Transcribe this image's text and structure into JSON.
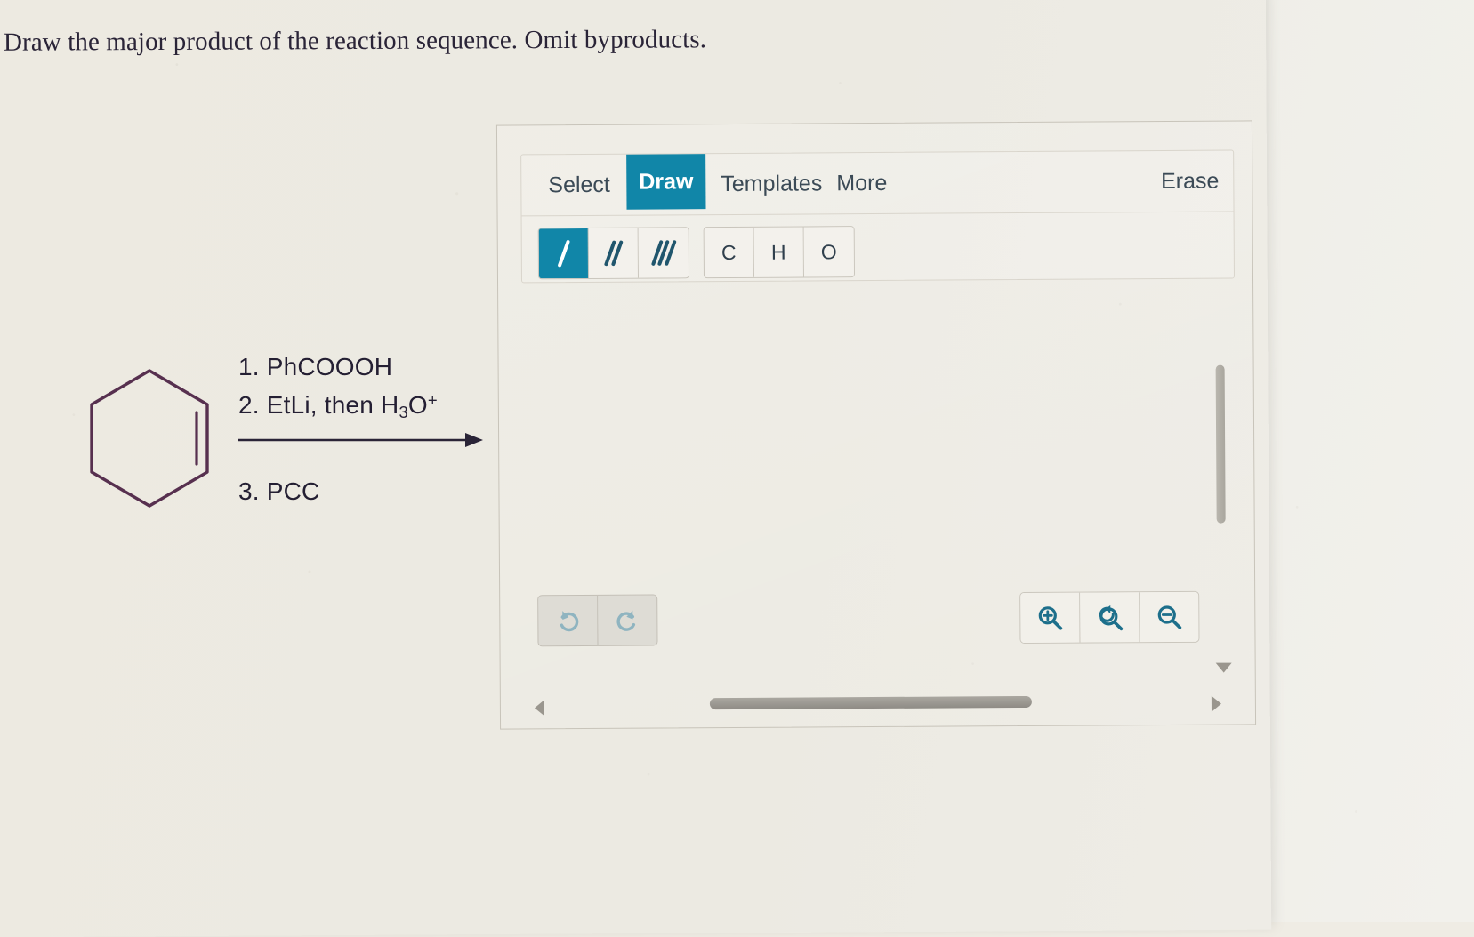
{
  "prompt": {
    "text": "Draw the major product of the reaction sequence. Omit byproducts."
  },
  "reaction": {
    "reactant_name": "cyclohexene",
    "conditions": [
      {
        "number": "1.",
        "reagent": "PhCOOOH"
      },
      {
        "number": "2.",
        "reagent": "EtLi, then H3O+"
      },
      {
        "number": "3.",
        "reagent": "PCC"
      }
    ],
    "condition_line_1": "1. PhCOOOH",
    "condition_line_2_prefix": "2. EtLi, then H",
    "condition_line_2_sub": "3",
    "condition_line_2_mid": "O",
    "condition_line_2_sup": "+",
    "condition_line_3": "3. PCC",
    "arrow": "reaction-arrow"
  },
  "editor": {
    "tabs": [
      {
        "id": "select",
        "label": "Select",
        "active": false
      },
      {
        "id": "draw",
        "label": "Draw",
        "active": true
      },
      {
        "id": "templates",
        "label": "Templates",
        "active": false
      },
      {
        "id": "more",
        "label": "More",
        "active": false
      }
    ],
    "tab_select_label": "Select",
    "tab_draw_label": "Draw",
    "tab_templates_label": "Templates",
    "tab_more_label": "More",
    "erase_label": "Erase",
    "bond_tools": [
      {
        "id": "single-bond",
        "icon": "single-bond-icon",
        "selected": true
      },
      {
        "id": "double-bond",
        "icon": "double-bond-icon",
        "selected": false
      },
      {
        "id": "triple-bond",
        "icon": "triple-bond-icon",
        "selected": false
      }
    ],
    "atom_tools": [
      {
        "id": "carbon",
        "label": "C"
      },
      {
        "id": "hydrogen",
        "label": "H"
      },
      {
        "id": "oxygen",
        "label": "O"
      }
    ],
    "atom_c_label": "C",
    "atom_h_label": "H",
    "atom_o_label": "O",
    "history_tools": [
      {
        "id": "undo",
        "icon": "undo-icon"
      },
      {
        "id": "redo",
        "icon": "redo-icon"
      }
    ],
    "zoom_tools": [
      {
        "id": "zoom-in",
        "icon": "zoom-in-icon"
      },
      {
        "id": "zoom-reset",
        "icon": "zoom-reset-icon"
      },
      {
        "id": "zoom-out",
        "icon": "zoom-out-icon"
      }
    ],
    "canvas_content": ""
  },
  "colors": {
    "accent_teal": "#1186a8",
    "icon_teal": "#2b7f99",
    "structure_purple": "#57304f",
    "text_dark": "#2a2437",
    "paper": "#edeae1"
  }
}
